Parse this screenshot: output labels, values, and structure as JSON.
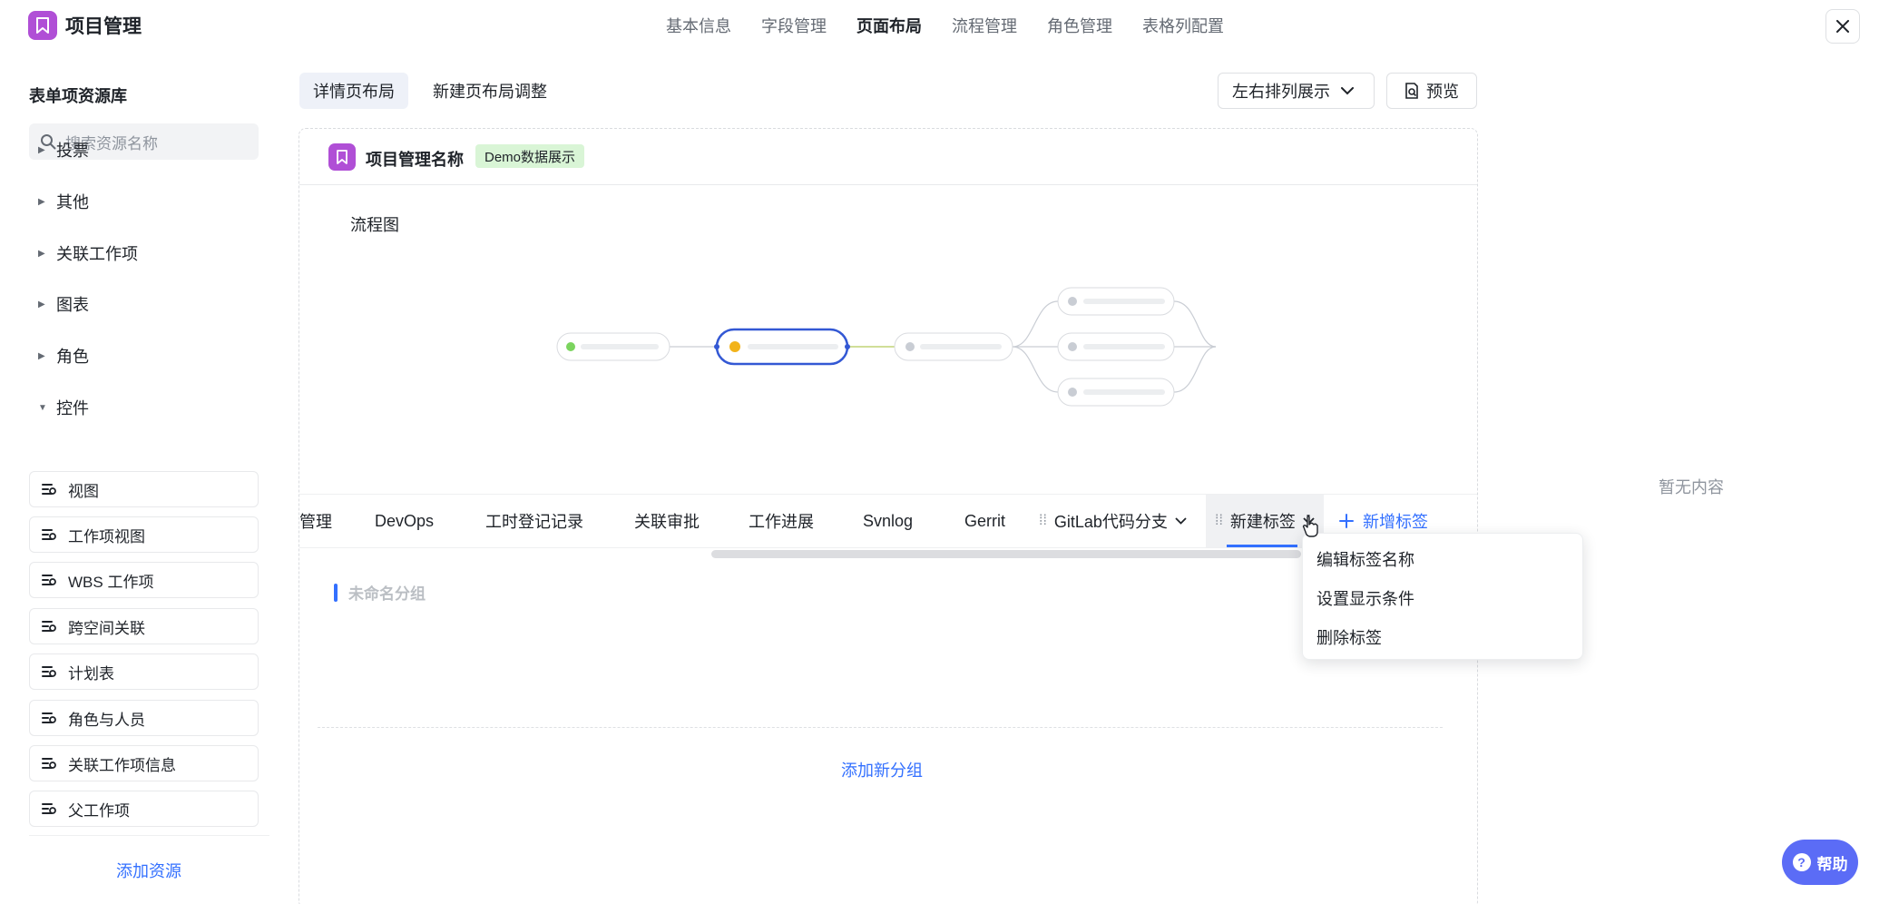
{
  "app": {
    "title": "项目管理"
  },
  "top_tabs": [
    "基本信息",
    "字段管理",
    "页面布局",
    "流程管理",
    "角色管理",
    "表格列配置"
  ],
  "active_top_tab": "页面布局",
  "sidebar": {
    "title": "表单项资源库",
    "search_placeholder": "搜索资源名称",
    "categories": [
      {
        "label": "投票",
        "expanded": false
      },
      {
        "label": "其他",
        "expanded": false
      },
      {
        "label": "关联工作项",
        "expanded": false
      },
      {
        "label": "图表",
        "expanded": false
      },
      {
        "label": "角色",
        "expanded": false
      },
      {
        "label": "控件",
        "expanded": true
      }
    ],
    "controls": [
      "视图",
      "工作项视图",
      "WBS 工作项",
      "跨空间关联",
      "计划表",
      "角色与人员",
      "关联工作项信息",
      "父工作项"
    ],
    "add_label": "添加资源"
  },
  "layout_tabs": [
    "详情页布局",
    "新建页布局调整"
  ],
  "arrange_select": "左右排列展示",
  "preview_label": "预览",
  "canvas": {
    "title": "项目管理名称",
    "badge": "Demo数据展示",
    "flow_title": "流程图"
  },
  "tags": [
    "管理",
    "DevOps",
    "工时登记记录",
    "关联审批",
    "工作进展",
    "Svnlog",
    "Gerrit",
    "GitLab代码分支",
    "新建标签"
  ],
  "add_tag_label": "新增标签",
  "group": {
    "title": "未命名分组",
    "add_label": "添加新分组"
  },
  "empty_text": "暂无内容",
  "dropdown": [
    "编辑标签名称",
    "设置显示条件",
    "删除标签"
  ],
  "help_label": "帮助",
  "colors": {
    "accent": "#3370ff",
    "brand": "#b04fd6",
    "badge_bg": "#d9f5d6"
  }
}
